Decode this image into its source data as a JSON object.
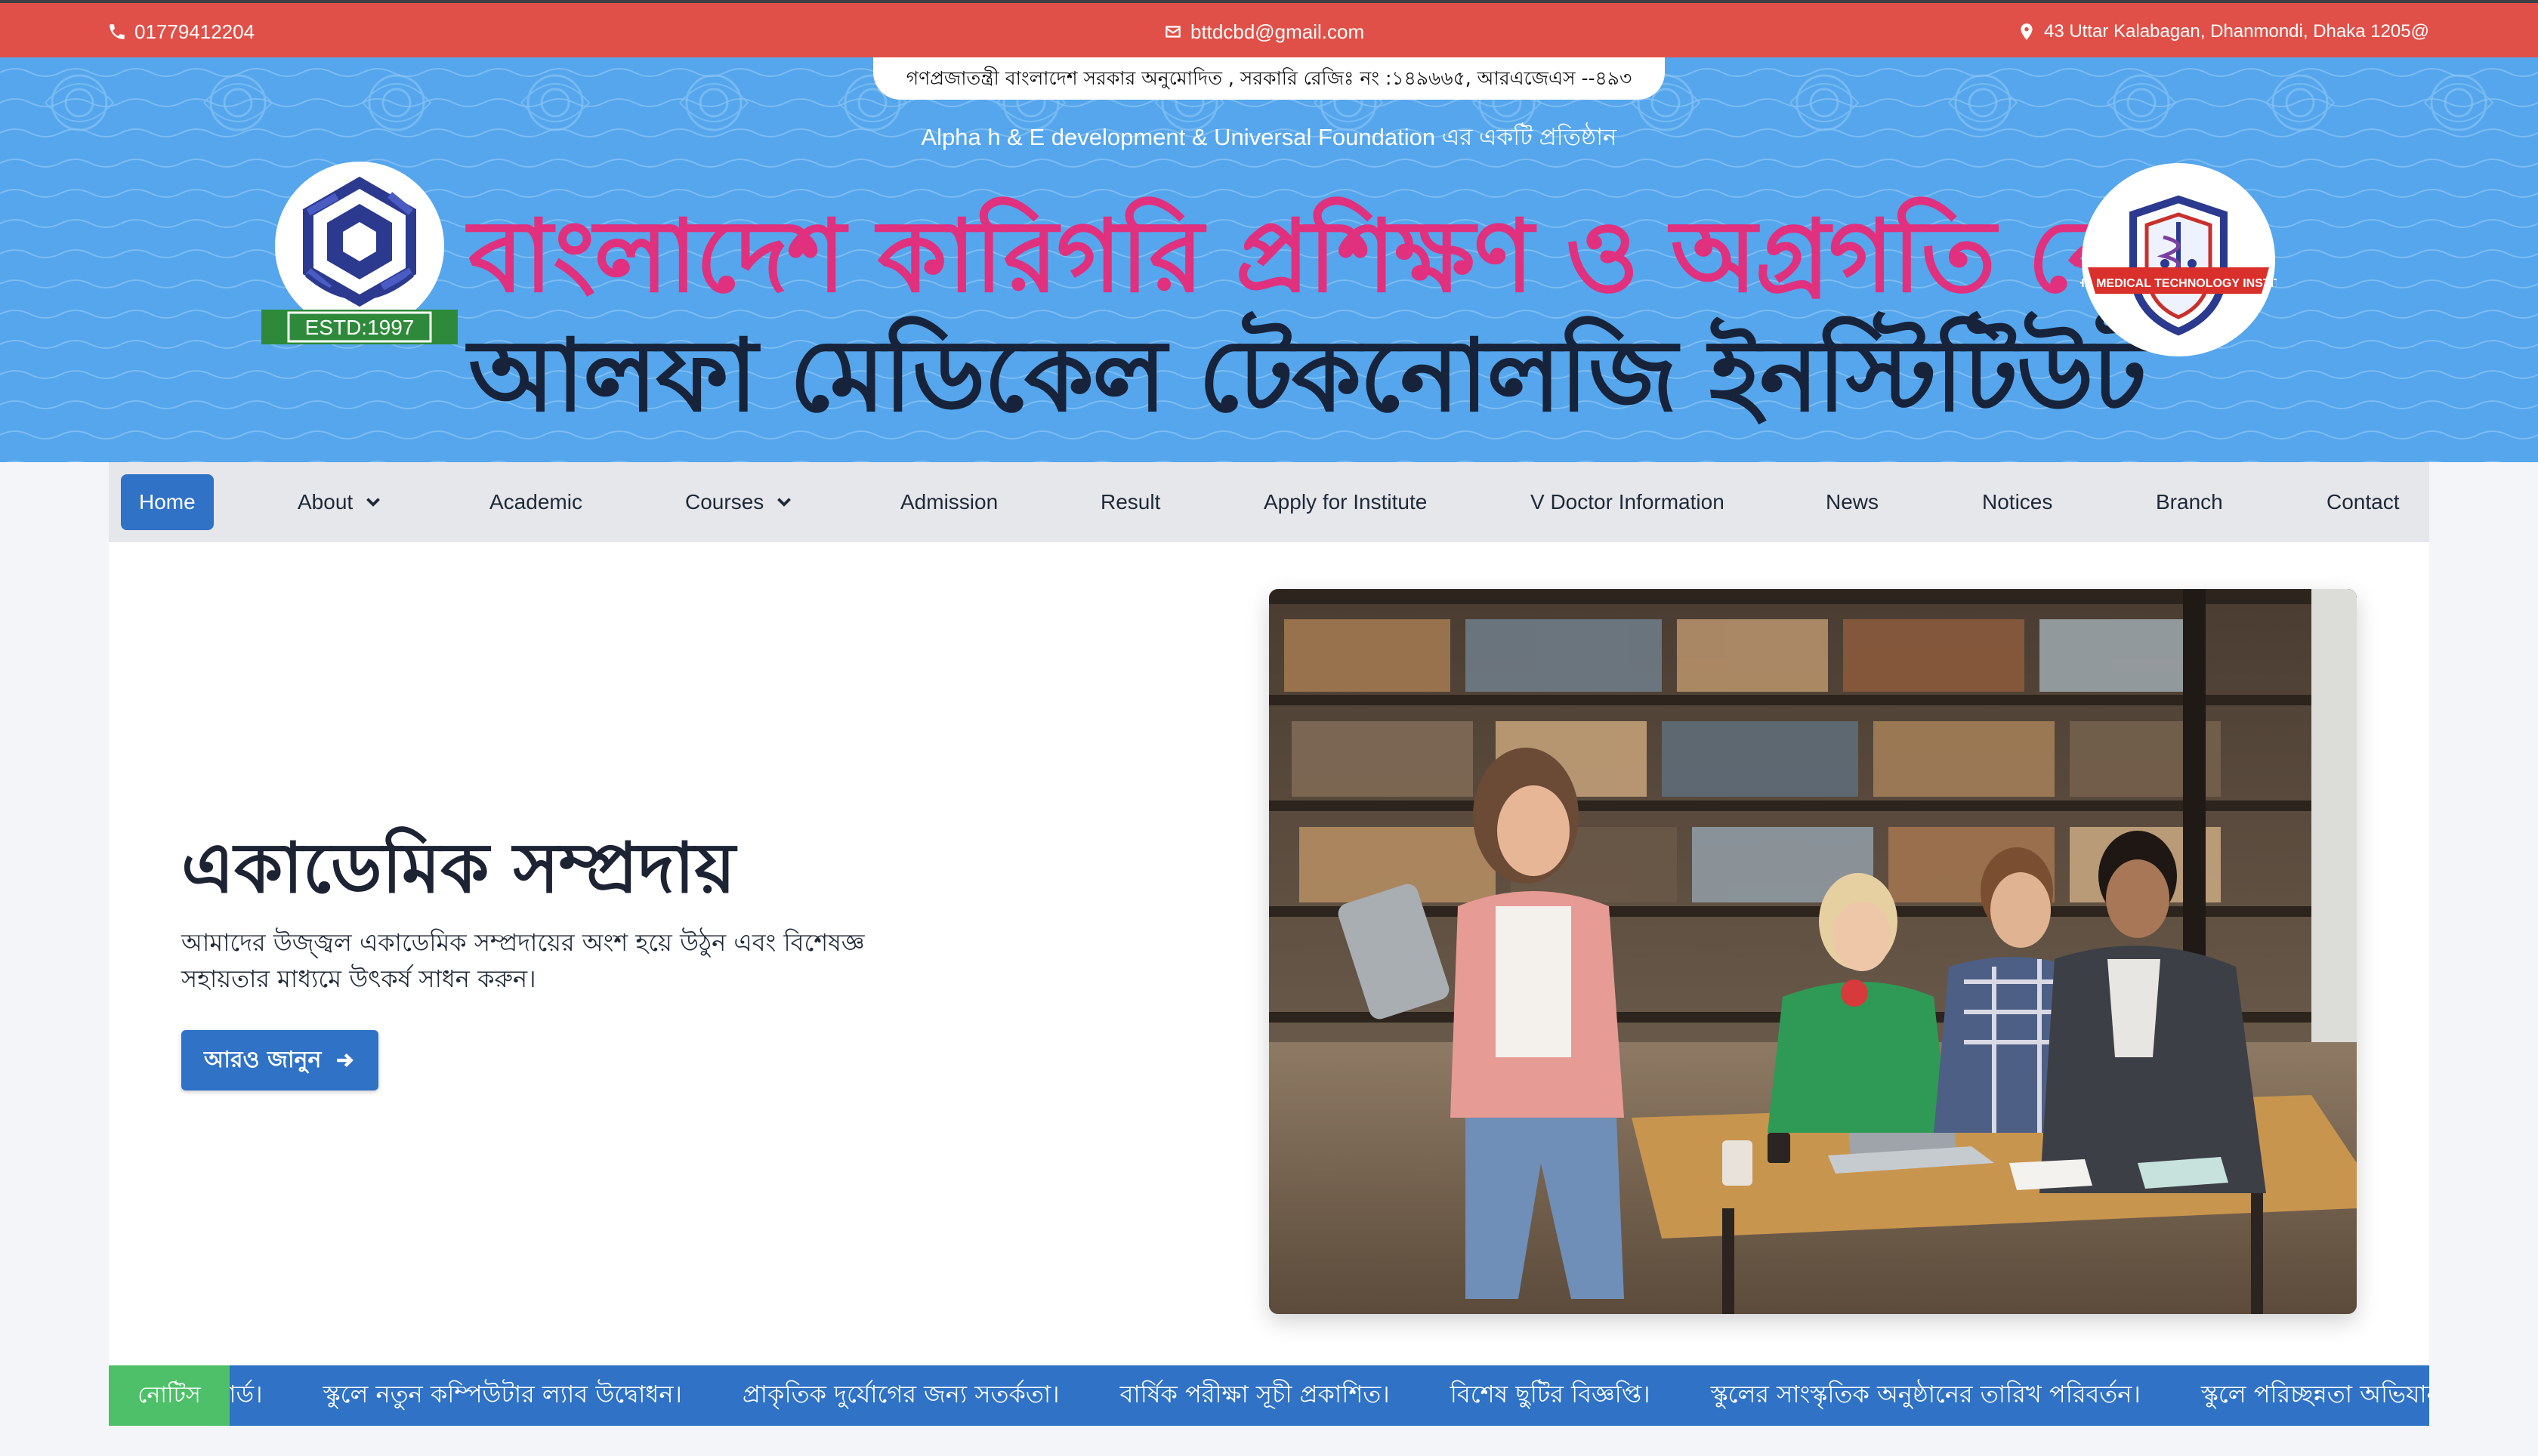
{
  "topbar": {
    "phone": "01779412204",
    "email": "bttdcbd@gmail.com",
    "address": "43 Uttar Kalabagan, Dhanmondi, Dhaka 1205@",
    "bg_color": "#e05048"
  },
  "header": {
    "govt_notice": "গণপ্রজাতন্ত্রী বাংলাদেশ সরকার অনুমোদিত , সরকারি রেজিঃ নং :১৪৯৬৬৫, আরএজেএস --৪৯৩",
    "sub_org": "Alpha h & E development & Universal Foundation এর একটি প্রতিষ্ঠান",
    "title_bn": "বাংলাদেশ কারিগরি প্রশিক্ষণ ও অগ্রগতি কেন্দ্র",
    "title_en": "আলফা মেডিকেল টেকনোলজি ইনস্টিটিউট",
    "logo_left_estd": "ESTD:1997",
    "logo_right_text": "ALPHA MEDICAL TECHNOLOGY INSTITUTE",
    "banner_color": "#55a6ec",
    "title_color": "#e1307d"
  },
  "nav": {
    "items": [
      {
        "label": "Home"
      },
      {
        "label": "About"
      },
      {
        "label": "Academic"
      },
      {
        "label": "Courses"
      },
      {
        "label": "Admission"
      },
      {
        "label": "Result"
      },
      {
        "label": "Apply for Institute"
      },
      {
        "label": "V Doctor Information"
      },
      {
        "label": "News"
      },
      {
        "label": "Notices"
      },
      {
        "label": "Branch"
      },
      {
        "label": "Contact"
      }
    ],
    "active_color": "#2f72c6"
  },
  "hero": {
    "heading": "একাডেমিক সম্প্রদায়",
    "text": "আমাদের উজ্জ্বল একাডেমিক সম্প্রদায়ের অংশ হয়ে উঠুন এবং বিশেষজ্ঞ সহায়তার মাধ্যমে উৎকর্ষ সাধন করুন।",
    "button_label": "আরও জানুন"
  },
  "ticker": {
    "label": "নোটিস",
    "items": [
      "রি কার্ড।",
      "স্কুলে নতুন কম্পিউটার ল্যাব উদ্বোধন।",
      "প্রাকৃতিক দুর্যোগের জন্য সতর্কতা।",
      "বার্ষিক পরীক্ষা সূচী প্রকাশিত।",
      "বিশেষ ছুটির বিজ্ঞপ্তি।",
      "স্কুলের সাংস্কৃতিক অনুষ্ঠানের তারিখ পরিবর্তন।",
      "স্কুলে পরিচ্ছন্নতা অভিযান।"
    ],
    "label_color": "#4fc06a"
  }
}
